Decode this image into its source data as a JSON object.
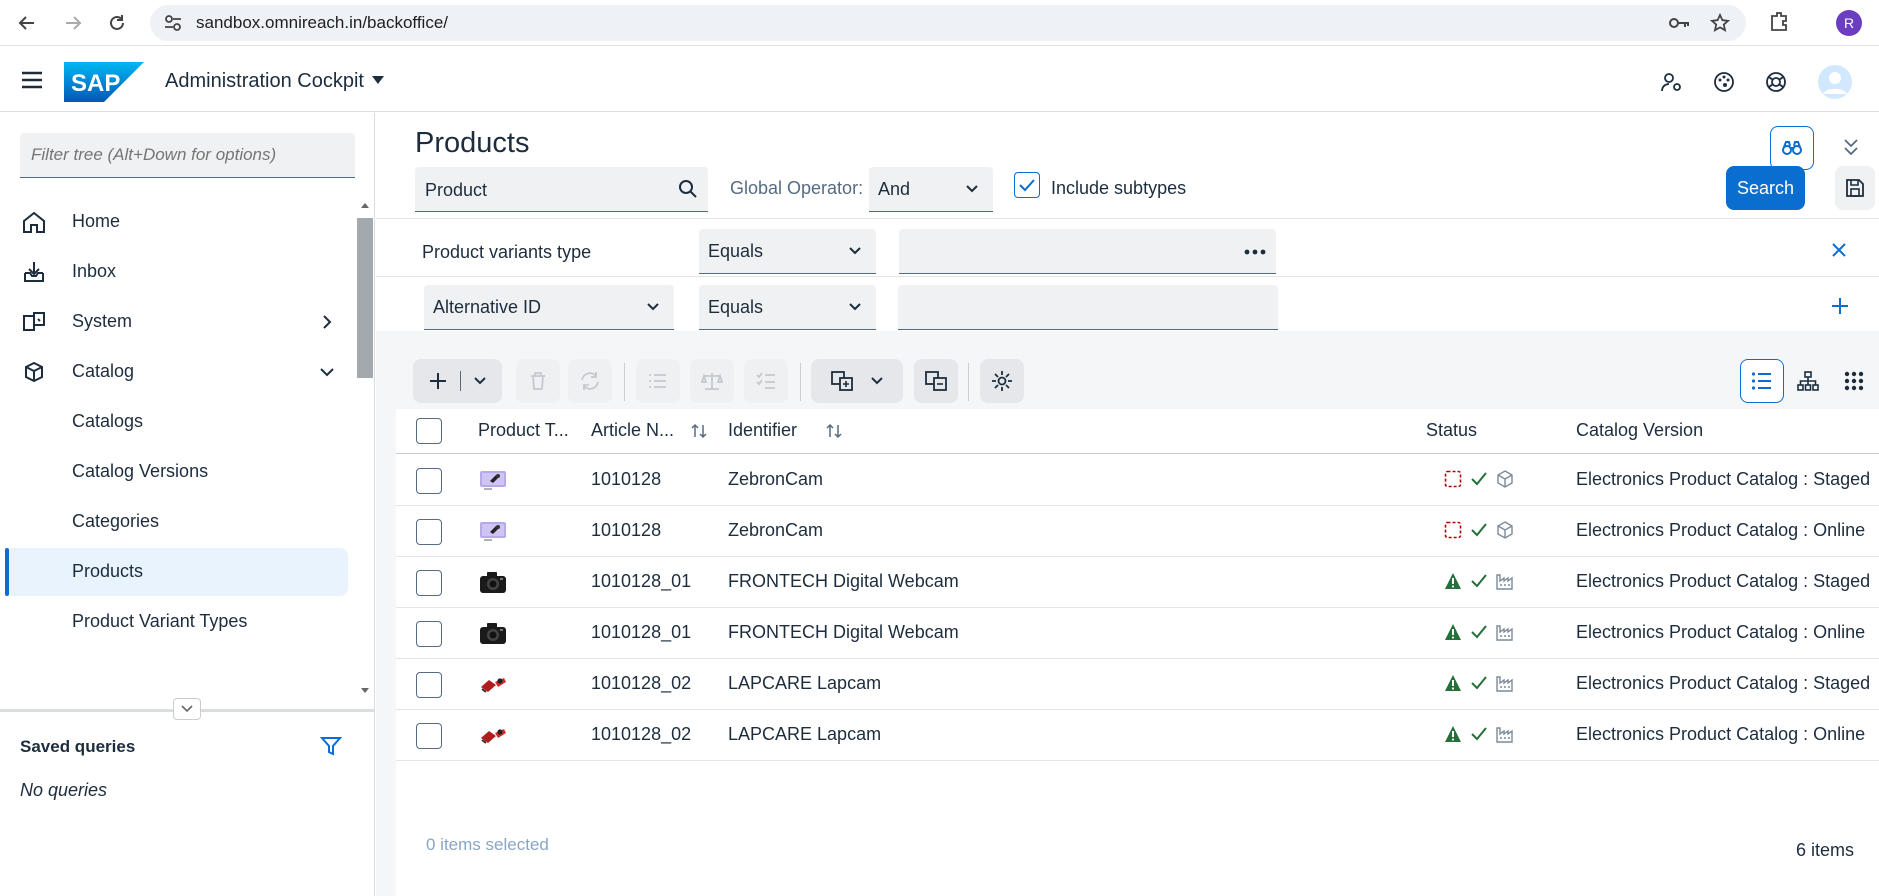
{
  "browser": {
    "url": "sandbox.omnireach.in/backoffice/",
    "profile_initial": "R"
  },
  "header": {
    "app_title": "Administration Cockpit",
    "logo_text": "SAP"
  },
  "sidebar": {
    "filter_placeholder": "Filter tree (Alt+Down for options)",
    "items": [
      {
        "label": "Home",
        "icon": "home-icon"
      },
      {
        "label": "Inbox",
        "icon": "inbox-icon"
      },
      {
        "label": "System",
        "icon": "system-icon"
      },
      {
        "label": "Catalog",
        "icon": "catalog-icon"
      },
      {
        "label": "Catalogs"
      },
      {
        "label": "Catalog Versions"
      },
      {
        "label": "Categories"
      },
      {
        "label": "Products"
      },
      {
        "label": "Product Variant Types"
      }
    ],
    "saved_queries_title": "Saved queries",
    "no_queries": "No queries"
  },
  "main": {
    "title": "Products",
    "type_field": "Product",
    "global_operator_label": "Global Operator:",
    "global_operator_value": "And",
    "include_subtypes_label": "Include subtypes",
    "search_label": "Search",
    "conditions": [
      {
        "field": "Product variants type",
        "operator": "Equals",
        "value": ""
      },
      {
        "field": "Alternative ID",
        "operator": "Equals",
        "value": ""
      }
    ]
  },
  "table": {
    "columns": [
      "Product T...",
      "Article N...",
      "Identifier",
      "Status",
      "Catalog Version"
    ],
    "rows": [
      {
        "article": "1010128",
        "identifier": "ZebronCam",
        "catalog_version": "Electronics Product Catalog : Staged",
        "thumb": "zebron"
      },
      {
        "article": "1010128",
        "identifier": "ZebronCam",
        "catalog_version": "Electronics Product Catalog : Online",
        "thumb": "zebron"
      },
      {
        "article": "1010128_01",
        "identifier": "FRONTECH Digital Webcam",
        "catalog_version": "Electronics Product Catalog : Staged",
        "thumb": "camera"
      },
      {
        "article": "1010128_01",
        "identifier": "FRONTECH Digital Webcam",
        "catalog_version": "Electronics Product Catalog : Online",
        "thumb": "camera"
      },
      {
        "article": "1010128_02",
        "identifier": "LAPCARE Lapcam",
        "catalog_version": "Electronics Product Catalog : Staged",
        "thumb": "lapcam"
      },
      {
        "article": "1010128_02",
        "identifier": "LAPCARE Lapcam",
        "catalog_version": "Electronics Product Catalog : Online",
        "thumb": "lapcam"
      }
    ],
    "selected_text": "0 items selected",
    "count_text": "6 items"
  },
  "colors": {
    "accent": "#0a6ed1",
    "warning_green": "#256f3a",
    "error_red": "#aa0808"
  }
}
